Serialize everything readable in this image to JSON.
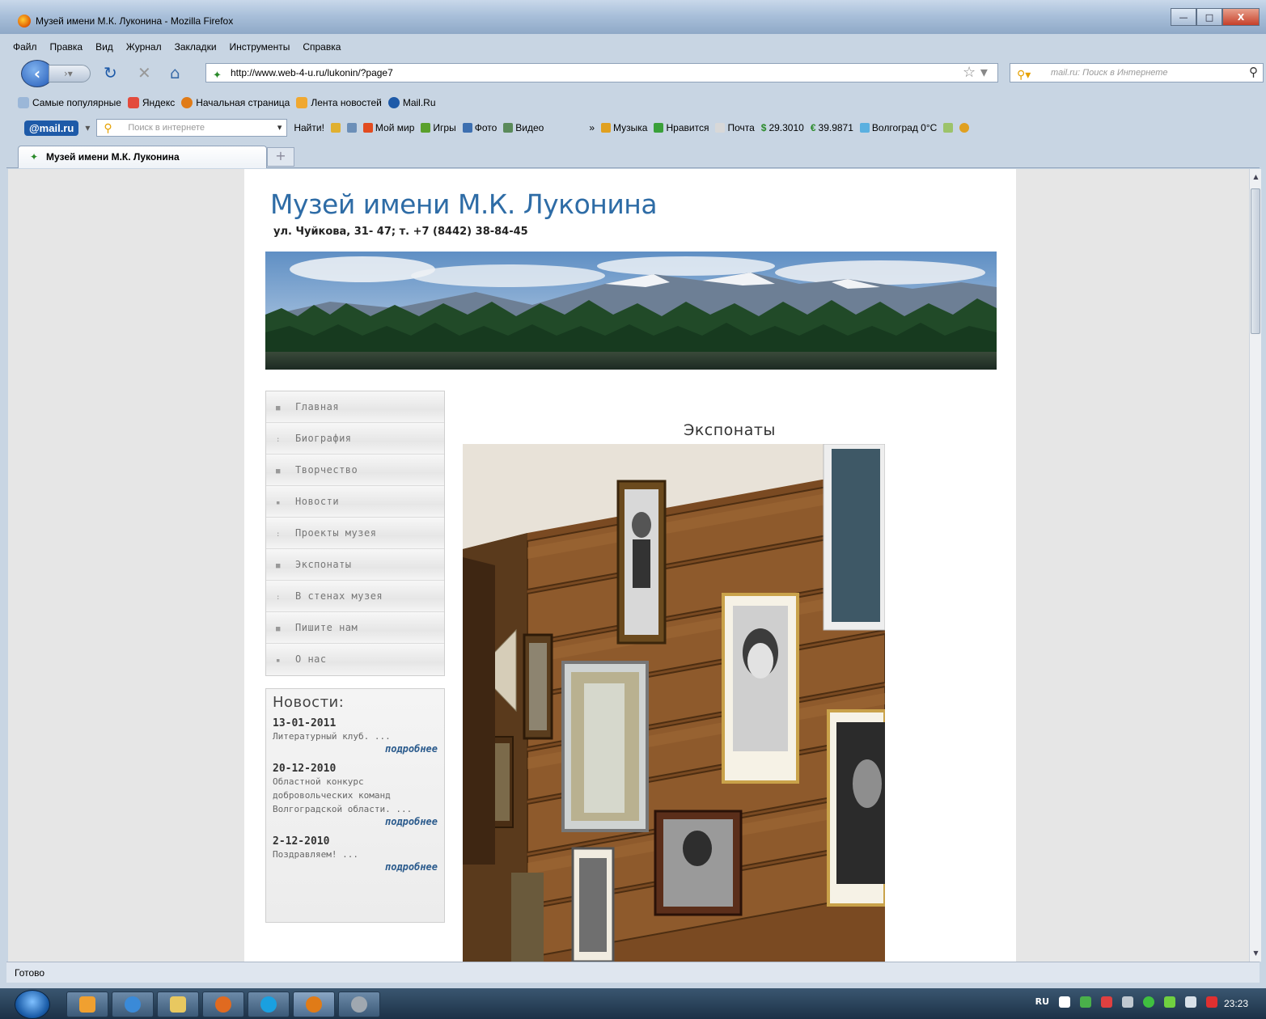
{
  "window": {
    "title": "Музей имени М.К. Луконина - Mozilla Firefox",
    "buttons": {
      "minimize": "—",
      "maximize": "□",
      "close": "X"
    }
  },
  "menubar": [
    "Файл",
    "Правка",
    "Вид",
    "Журнал",
    "Закладки",
    "Инструменты",
    "Справка"
  ],
  "navbar": {
    "url": "http://www.web-4-u.ru/lukonin/?page7",
    "search_placeholder": "mail.ru: Поиск в Интернете"
  },
  "bookmarks": [
    "Самые популярные",
    "Яндекс",
    "Начальная страница",
    "Лента новостей",
    "Mail.Ru"
  ],
  "mailbar": {
    "logo": "@mail.ru",
    "search_placeholder": "Поиск в интернете",
    "find_label": "Найти!",
    "items": [
      "Мой мир",
      "Игры",
      "Фото",
      "Видео"
    ],
    "overflow": "»",
    "right_items": [
      "Музыка",
      "Нравится",
      "Почта",
      "29.3010",
      "39.9871",
      "Волгоград 0°C"
    ]
  },
  "tab": {
    "title": "Музей имени М.К. Луконина",
    "new_tab": "+"
  },
  "site": {
    "title": "Музей имени М.К. Луконина",
    "address": "ул. Чуйкова, 31- 47; т. +7 (8442) 38-84-45",
    "menu": [
      {
        "label": "Главная",
        "bullet": "■"
      },
      {
        "label": "Биография",
        "bullet": ":"
      },
      {
        "label": "Творчество",
        "bullet": "■"
      },
      {
        "label": "Новости",
        "bullet": "▪"
      },
      {
        "label": "Проекты музея",
        "bullet": ":"
      },
      {
        "label": "Экспонаты",
        "bullet": "■"
      },
      {
        "label": "В стенах музея",
        "bullet": ":"
      },
      {
        "label": "Пишите нам",
        "bullet": "■"
      },
      {
        "label": "О нас",
        "bullet": "▪"
      }
    ],
    "news": {
      "title": "Новости:",
      "items": [
        {
          "date": "13-01-2011",
          "text": "Литературный клуб. ...",
          "more": "подробнее"
        },
        {
          "date": "20-12-2010",
          "text": "Областной конкурс добровольческих команд Волгоградской области. ...",
          "more": "подробнее"
        },
        {
          "date": "2-12-2010",
          "text": "Поздравляем! ...",
          "more": "подробнее"
        }
      ]
    },
    "content_heading": "Экспонаты"
  },
  "status": "Готово",
  "taskbar": {
    "clock": "23:23",
    "lang": "RU"
  },
  "colors": {
    "title_blue": "#2e6ca6",
    "news_link": "#2a5a8c",
    "page_bg": "#e6e6e6"
  }
}
